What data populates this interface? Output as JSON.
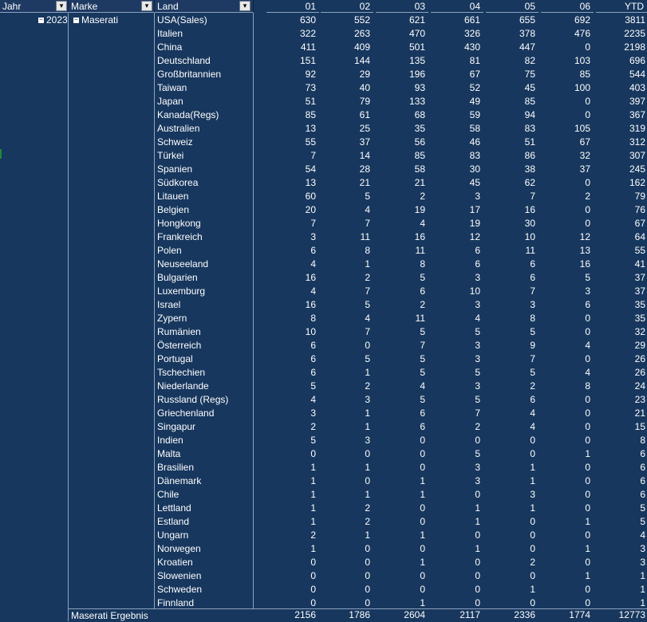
{
  "header": {
    "fields": [
      "Jahr",
      "Marke",
      "Land"
    ],
    "columns": [
      "01",
      "02",
      "03",
      "04",
      "05",
      "06",
      "YTD"
    ]
  },
  "year": "2023",
  "brand": "Maserati",
  "rows": [
    {
      "land": "USA(Sales)",
      "v": [
        630,
        552,
        621,
        661,
        655,
        692,
        3811
      ]
    },
    {
      "land": "Italien",
      "v": [
        322,
        263,
        470,
        326,
        378,
        476,
        2235
      ]
    },
    {
      "land": "China",
      "v": [
        411,
        409,
        501,
        430,
        447,
        0,
        2198
      ]
    },
    {
      "land": "Deutschland",
      "v": [
        151,
        144,
        135,
        81,
        82,
        103,
        696
      ]
    },
    {
      "land": "Großbritannien",
      "v": [
        92,
        29,
        196,
        67,
        75,
        85,
        544
      ]
    },
    {
      "land": "Taiwan",
      "v": [
        73,
        40,
        93,
        52,
        45,
        100,
        403
      ]
    },
    {
      "land": "Japan",
      "v": [
        51,
        79,
        133,
        49,
        85,
        0,
        397
      ]
    },
    {
      "land": "Kanada(Regs)",
      "v": [
        85,
        61,
        68,
        59,
        94,
        0,
        367
      ]
    },
    {
      "land": "Australien",
      "v": [
        13,
        25,
        35,
        58,
        83,
        105,
        319
      ]
    },
    {
      "land": "Schweiz",
      "v": [
        55,
        37,
        56,
        46,
        51,
        67,
        312
      ]
    },
    {
      "land": "Türkei",
      "v": [
        7,
        14,
        85,
        83,
        86,
        32,
        307
      ]
    },
    {
      "land": "Spanien",
      "v": [
        54,
        28,
        58,
        30,
        38,
        37,
        245
      ]
    },
    {
      "land": "Südkorea",
      "v": [
        13,
        21,
        21,
        45,
        62,
        0,
        162
      ]
    },
    {
      "land": "Litauen",
      "v": [
        60,
        5,
        2,
        3,
        7,
        2,
        79
      ]
    },
    {
      "land": "Belgien",
      "v": [
        20,
        4,
        19,
        17,
        16,
        0,
        76
      ]
    },
    {
      "land": "Hongkong",
      "v": [
        7,
        7,
        4,
        19,
        30,
        0,
        67
      ]
    },
    {
      "land": "Frankreich",
      "v": [
        3,
        11,
        16,
        12,
        10,
        12,
        64
      ]
    },
    {
      "land": "Polen",
      "v": [
        6,
        8,
        11,
        6,
        11,
        13,
        55
      ]
    },
    {
      "land": "Neuseeland",
      "v": [
        4,
        1,
        8,
        6,
        6,
        16,
        41
      ]
    },
    {
      "land": "Bulgarien",
      "v": [
        16,
        2,
        5,
        3,
        6,
        5,
        37
      ]
    },
    {
      "land": "Luxemburg",
      "v": [
        4,
        7,
        6,
        10,
        7,
        3,
        37
      ]
    },
    {
      "land": "Israel",
      "v": [
        16,
        5,
        2,
        3,
        3,
        6,
        35
      ]
    },
    {
      "land": "Zypern",
      "v": [
        8,
        4,
        11,
        4,
        8,
        0,
        35
      ]
    },
    {
      "land": "Rumänien",
      "v": [
        10,
        7,
        5,
        5,
        5,
        0,
        32
      ]
    },
    {
      "land": "Österreich",
      "v": [
        6,
        0,
        7,
        3,
        9,
        4,
        29
      ]
    },
    {
      "land": "Portugal",
      "v": [
        6,
        5,
        5,
        3,
        7,
        0,
        26
      ]
    },
    {
      "land": "Tschechien",
      "v": [
        6,
        1,
        5,
        5,
        5,
        4,
        26
      ]
    },
    {
      "land": "Niederlande",
      "v": [
        5,
        2,
        4,
        3,
        2,
        8,
        24
      ]
    },
    {
      "land": "Russland (Regs)",
      "v": [
        4,
        3,
        5,
        5,
        6,
        0,
        23
      ]
    },
    {
      "land": "Griechenland",
      "v": [
        3,
        1,
        6,
        7,
        4,
        0,
        21
      ]
    },
    {
      "land": "Singapur",
      "v": [
        2,
        1,
        6,
        2,
        4,
        0,
        15
      ]
    },
    {
      "land": "Indien",
      "v": [
        5,
        3,
        0,
        0,
        0,
        0,
        8
      ]
    },
    {
      "land": "Malta",
      "v": [
        0,
        0,
        0,
        5,
        0,
        1,
        6
      ]
    },
    {
      "land": "Brasilien",
      "v": [
        1,
        1,
        0,
        3,
        1,
        0,
        6
      ]
    },
    {
      "land": "Dänemark",
      "v": [
        1,
        0,
        1,
        3,
        1,
        0,
        6
      ]
    },
    {
      "land": "Chile",
      "v": [
        1,
        1,
        1,
        0,
        3,
        0,
        6
      ]
    },
    {
      "land": "Lettland",
      "v": [
        1,
        2,
        0,
        1,
        1,
        0,
        5
      ]
    },
    {
      "land": "Estland",
      "v": [
        1,
        2,
        0,
        1,
        0,
        1,
        5
      ]
    },
    {
      "land": "Ungarn",
      "v": [
        2,
        1,
        1,
        0,
        0,
        0,
        4
      ]
    },
    {
      "land": "Norwegen",
      "v": [
        1,
        0,
        0,
        1,
        0,
        1,
        3
      ]
    },
    {
      "land": "Kroatien",
      "v": [
        0,
        0,
        1,
        0,
        2,
        0,
        3
      ]
    },
    {
      "land": "Slowenien",
      "v": [
        0,
        0,
        0,
        0,
        0,
        1,
        1
      ]
    },
    {
      "land": "Schweden",
      "v": [
        0,
        0,
        0,
        0,
        1,
        0,
        1
      ]
    },
    {
      "land": "Finnland",
      "v": [
        0,
        0,
        1,
        0,
        0,
        0,
        1
      ]
    }
  ],
  "total": {
    "label": "Maserati Ergebnis",
    "v": [
      2156,
      1786,
      2604,
      2117,
      2336,
      1774,
      12773
    ]
  }
}
